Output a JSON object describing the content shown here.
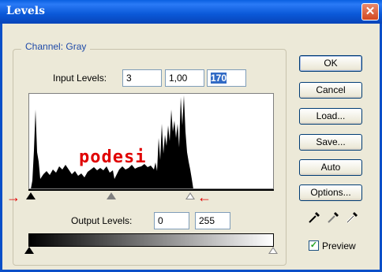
{
  "window": {
    "title": "Levels",
    "close_glyph": "✕"
  },
  "channel": {
    "label": "Channel:",
    "value": "Gray"
  },
  "input_levels": {
    "label": "Input Levels:",
    "black": "3",
    "gamma": "1,00",
    "white": "170"
  },
  "output_levels": {
    "label": "Output Levels:",
    "black": "0",
    "white": "255"
  },
  "buttons": {
    "ok": "OK",
    "cancel": "Cancel",
    "load": "Load...",
    "save": "Save...",
    "auto": "Auto",
    "options": "Options..."
  },
  "preview": {
    "label": "Preview",
    "checked": true,
    "check_glyph": "✓"
  },
  "watermark": "podesi",
  "arrows": {
    "left": "→",
    "right": "←"
  },
  "icons": [
    "black-eyedropper-icon",
    "gray-eyedropper-icon",
    "white-eyedropper-icon"
  ],
  "colors": {
    "titlebar": "#0a58d8",
    "accent": "#316ac5",
    "arrow": "#e00000"
  }
}
